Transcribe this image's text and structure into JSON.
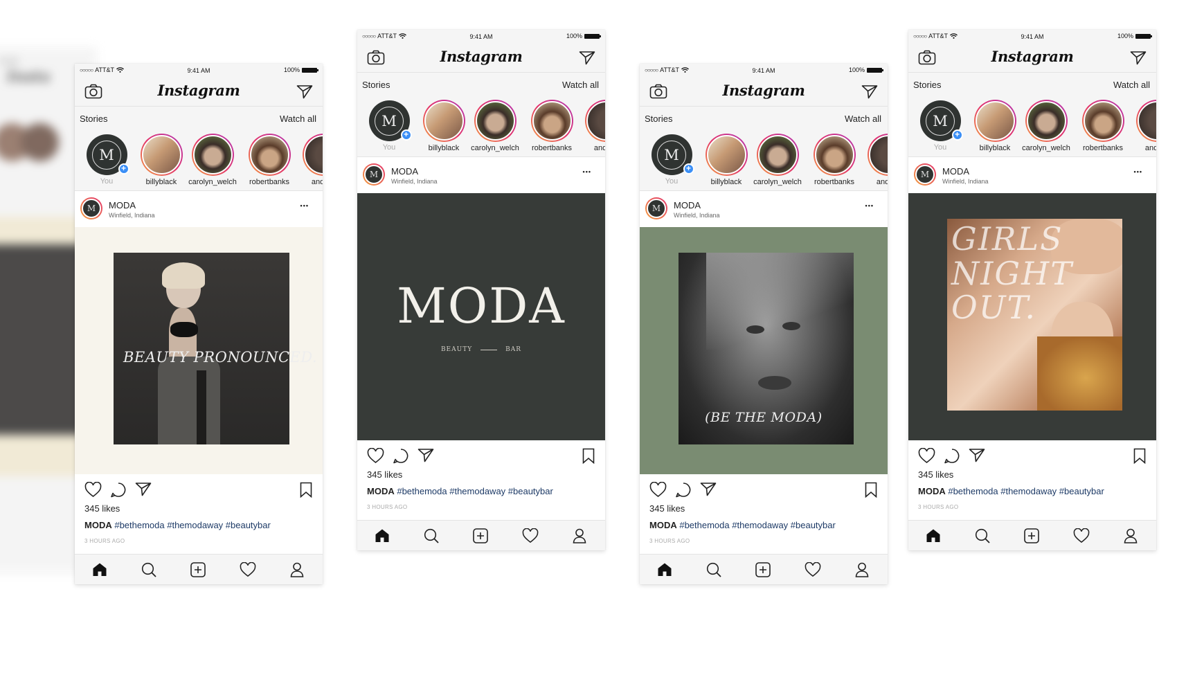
{
  "status": {
    "carrier": "ATT&T",
    "signal_dots": "○○○○○",
    "time": "9:41 AM",
    "battery": "100%"
  },
  "nav": {
    "logo": "Instagram",
    "camera_icon": "camera-icon",
    "send_icon": "send-icon"
  },
  "stories": {
    "heading": "Stories",
    "watch_all": "Watch all",
    "items": [
      {
        "label": "You"
      },
      {
        "label": "billyblack"
      },
      {
        "label": "carolyn_welch"
      },
      {
        "label": "robertbanks"
      },
      {
        "label": "andrea"
      }
    ]
  },
  "post": {
    "account": "MODA",
    "location": "Winfield, Indiana",
    "more": "•••",
    "likes": "345 likes",
    "caption_user": "MODA",
    "caption_tags": "#bethemoda #themodaway #beautybar",
    "time_ago": "3 HOURS AGO"
  },
  "phones": [
    {
      "post_text": "BEAUTY PRONOUNCED."
    },
    {
      "post_title": "MODA",
      "post_sub_left": "BEAUTY",
      "post_sub_right": "BAR"
    },
    {
      "post_text": "(BE THE MODA)"
    },
    {
      "post_text": "GIRLS NIGHT OUT."
    }
  ],
  "tabs": [
    "home-icon",
    "search-icon",
    "add-post-icon",
    "activity-heart-icon",
    "profile-icon"
  ],
  "colors": {
    "dark_green": "#2f3331",
    "sage": "#7a8c72",
    "cream": "#f7f4ec",
    "link": "#1d3a66",
    "plus_badge": "#3b8ff6"
  }
}
